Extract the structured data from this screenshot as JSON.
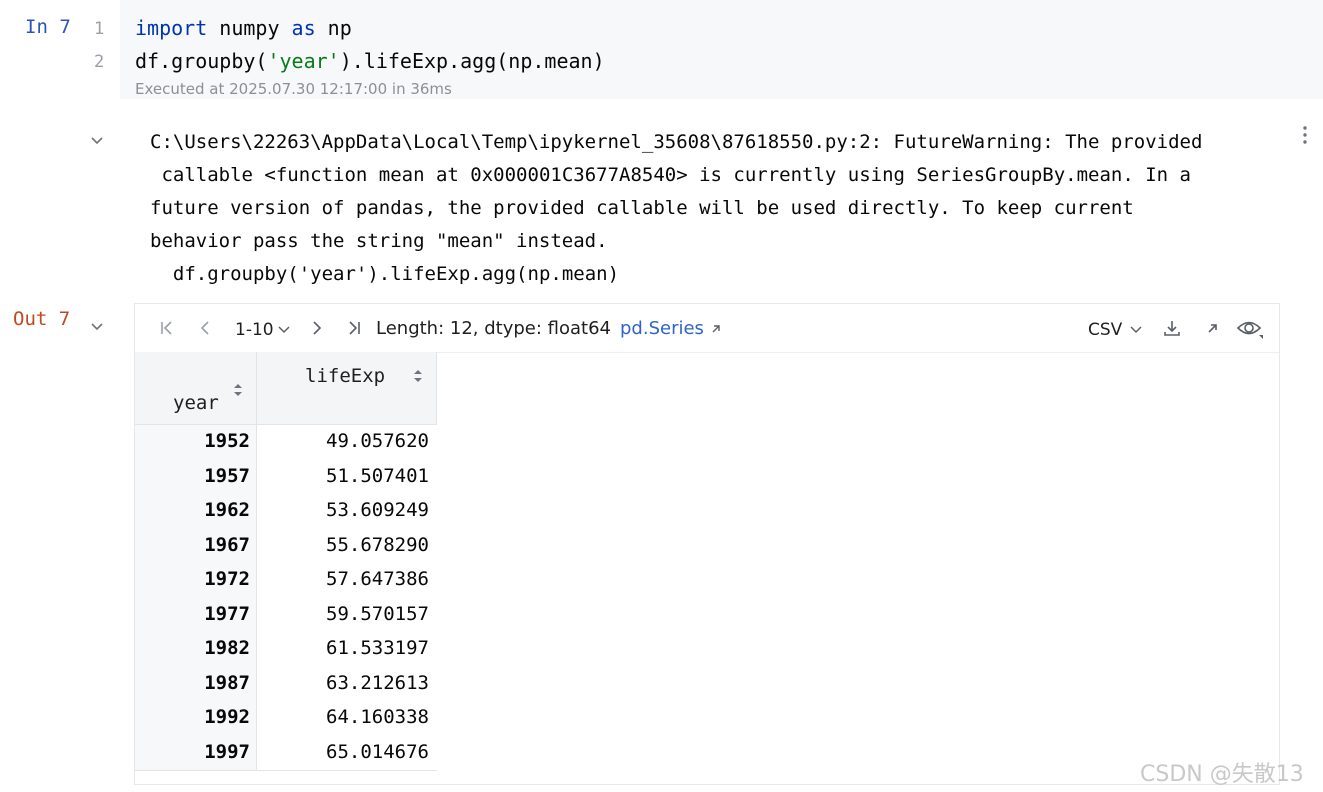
{
  "input_cell": {
    "label": "In 7",
    "line_numbers": [
      "1",
      "2"
    ],
    "lines": [
      [
        {
          "t": "import",
          "k": "kw"
        },
        {
          "t": " numpy ",
          "k": ""
        },
        {
          "t": "as",
          "k": "kw"
        },
        {
          "t": " np",
          "k": ""
        }
      ],
      [
        {
          "t": "df.groupby(",
          "k": ""
        },
        {
          "t": "'year'",
          "k": "str"
        },
        {
          "t": ").lifeExp.agg(np.mean)",
          "k": ""
        }
      ]
    ],
    "execution_info": "Executed at 2025.07.30 12:17:00 in 36ms"
  },
  "warning_output": {
    "text": "C:\\Users\\22263\\AppData\\Local\\Temp\\ipykernel_35608\\87618550.py:2: FutureWarning: The provided\n callable <function mean at 0x000001C3677A8540> is currently using SeriesGroupBy.mean. In a\nfuture version of pandas, the provided callable will be used directly. To keep current\nbehavior pass the string \"mean\" instead.\n  df.groupby('year').lifeExp.agg(np.mean)"
  },
  "output_cell": {
    "label": "Out 7",
    "toolbar": {
      "page_range": "1-10",
      "length_info": "Length: 12, dtype: float64",
      "type_link": "pd.Series",
      "export_format": "CSV"
    },
    "table": {
      "index_header": "year",
      "value_header": "lifeExp",
      "rows": [
        {
          "year": "1952",
          "value": "49.057620"
        },
        {
          "year": "1957",
          "value": "51.507401"
        },
        {
          "year": "1962",
          "value": "53.609249"
        },
        {
          "year": "1967",
          "value": "55.678290"
        },
        {
          "year": "1972",
          "value": "57.647386"
        },
        {
          "year": "1977",
          "value": "59.570157"
        },
        {
          "year": "1982",
          "value": "61.533197"
        },
        {
          "year": "1987",
          "value": "63.212613"
        },
        {
          "year": "1992",
          "value": "64.160338"
        },
        {
          "year": "1997",
          "value": "65.014676"
        }
      ]
    }
  },
  "watermark": "CSDN @失散13",
  "colors": {
    "keyword": "#0033b3",
    "string": "#067d17",
    "in_label": "#2a55b8",
    "out_label": "#c04a1f",
    "link": "#2f63c9"
  }
}
